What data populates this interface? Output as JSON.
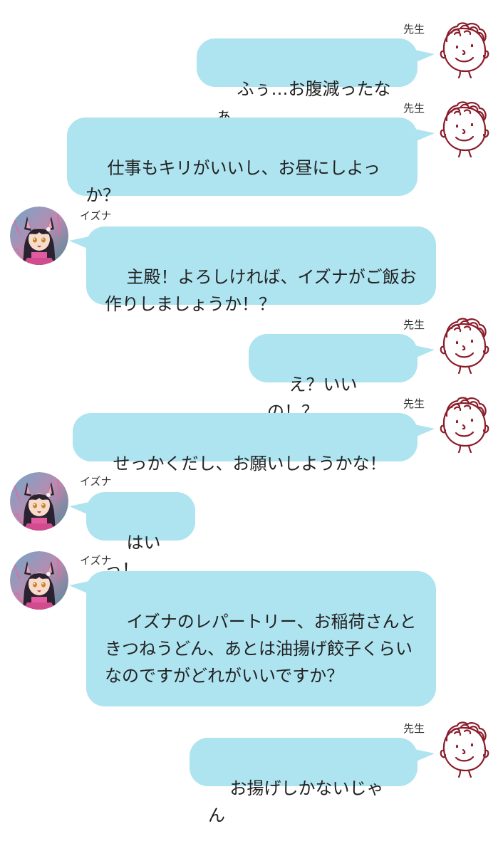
{
  "speakers": {
    "sensei": "先生",
    "izuna": "イズナ"
  },
  "messages": [
    {
      "speaker": "先生",
      "text": "ふぅ…お腹減ったなぁ"
    },
    {
      "speaker": "先生",
      "text": "仕事もキリがいいし、お昼にしよっか？"
    },
    {
      "speaker": "イズナ",
      "text": "主殿！よろしければ、イズナがご飯お作りしましょうか！？"
    },
    {
      "speaker": "先生",
      "text": "え？いいの！？"
    },
    {
      "speaker": "先生",
      "text": "せっかくだし、お願いしようかな！"
    },
    {
      "speaker": "イズナ",
      "text": "はいっ！"
    },
    {
      "speaker": "イズナ",
      "text": "イズナのレパートリー、お稲荷さんときつねうどん、あとは油揚げ餃子くらいなのですがどれがいいですか？"
    },
    {
      "speaker": "先生",
      "text": "お揚げしかないじゃん"
    }
  ],
  "colors": {
    "bubble": "#aee3f0",
    "sensei_sketch": "#8a1c2a",
    "background": "#ffffff"
  },
  "icons": {
    "sensei_avatar": "smiley-sketch-icon",
    "izuna_avatar": "fox-girl-avatar-icon"
  }
}
